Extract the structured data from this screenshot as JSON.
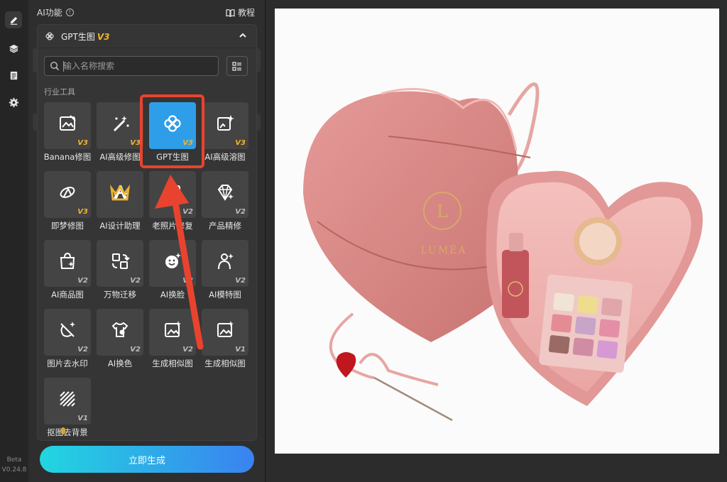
{
  "rail": {
    "version_beta": "Beta",
    "version_number": "V0.24.8"
  },
  "panel": {
    "title": "AI功能",
    "tutorial": "教程",
    "card_title": "GPT生图",
    "card_version": "V3",
    "search_placeholder": "输入名称搜索",
    "section_label": "行业工具",
    "generate_label": "立即生成"
  },
  "tools": [
    {
      "label": "Banana修图",
      "badge": "V3",
      "badge_color": "#f0b32e",
      "icon": "image-edit-icon"
    },
    {
      "label": "AI高级修图",
      "badge": "V3",
      "badge_color": "#f0b32e",
      "icon": "magic-wand-icon"
    },
    {
      "label": "GPT生图",
      "badge": "V3",
      "badge_color": "#f0b32e",
      "icon": "gpt-swirl-icon",
      "selected": true
    },
    {
      "label": "AI高级溶图",
      "badge": "V3",
      "badge_color": "#f0b32e",
      "icon": "image-sparkle-icon"
    },
    {
      "label": "即梦修图",
      "badge": "V3",
      "badge_color": "#f0b32e",
      "icon": "dream-icon"
    },
    {
      "label": "AI设计助理",
      "badge": "",
      "badge_color": "#f0b32e",
      "icon": "design-assistant-icon"
    },
    {
      "label": "老照片修复",
      "badge": "V2",
      "badge_color": "#bbbbbb",
      "icon": "photo-restore-icon"
    },
    {
      "label": "产品精修",
      "badge": "V2",
      "badge_color": "#bbbbbb",
      "icon": "diamond-icon"
    },
    {
      "label": "AI商品图",
      "badge": "V2",
      "badge_color": "#bbbbbb",
      "icon": "shopping-bag-icon"
    },
    {
      "label": "万物迁移",
      "badge": "V2",
      "badge_color": "#bbbbbb",
      "icon": "transfer-icon"
    },
    {
      "label": "AI换脸",
      "badge": "V2",
      "badge_color": "#bbbbbb",
      "icon": "face-swap-icon"
    },
    {
      "label": "AI模特图",
      "badge": "V2",
      "badge_color": "#bbbbbb",
      "icon": "model-icon"
    },
    {
      "label": "图片去水印",
      "badge": "V2",
      "badge_color": "#bbbbbb",
      "icon": "remove-watermark-icon"
    },
    {
      "label": "AI换色",
      "badge": "V2",
      "badge_color": "#bbbbbb",
      "icon": "tshirt-color-icon"
    },
    {
      "label": "生成相似图",
      "badge": "V2",
      "badge_color": "#bbbbbb",
      "icon": "similar-image-icon"
    },
    {
      "label": "生成相似图",
      "badge": "V1",
      "badge_color": "#bbbbbb",
      "icon": "similar-image-icon"
    },
    {
      "label": "抠图去背景",
      "badge": "V1",
      "badge_color": "#bbbbbb",
      "icon": "cutout-background-icon"
    }
  ],
  "photo": {
    "brand": "LUMÉA",
    "logo_letter": "L"
  },
  "colors": {
    "accent": "#2f9ee8",
    "highlight": "#e8432e",
    "version_gold": "#f0b32e"
  }
}
